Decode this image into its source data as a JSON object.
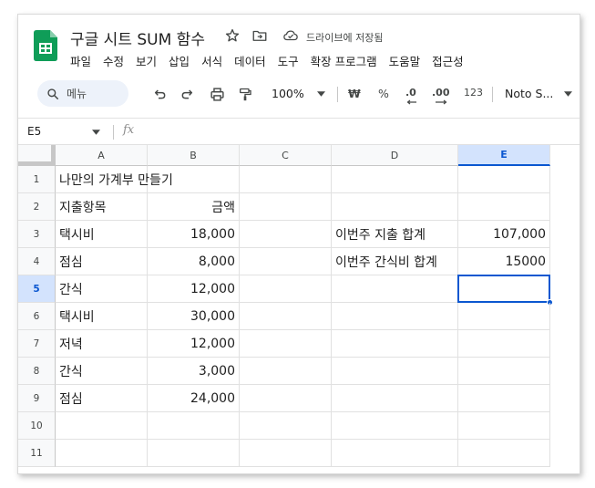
{
  "app": {
    "title": "구글 시트 SUM 함수",
    "drive_status": "드라이브에 저장됨"
  },
  "menu": [
    "파일",
    "수정",
    "보기",
    "삽입",
    "서식",
    "데이터",
    "도구",
    "확장 프로그램",
    "도움말",
    "접근성"
  ],
  "toolbar": {
    "search_label": "메뉴",
    "zoom": "100%",
    "currency": "₩",
    "percent": "%",
    "decimal_decrease": ".0",
    "decimal_increase": ".00",
    "format_more": "123",
    "font": "Noto S..."
  },
  "formula_bar": {
    "name_box": "E5",
    "fx": "fx",
    "value": ""
  },
  "sheet": {
    "columns": [
      "A",
      "B",
      "C",
      "D",
      "E"
    ],
    "selected_column": "E",
    "rows": [
      "1",
      "2",
      "3",
      "4",
      "5",
      "6",
      "7",
      "8",
      "9",
      "10",
      "11"
    ],
    "selected_row": "5",
    "selected_cell": "E5",
    "cells": {
      "A1": "나만의 가계부 만들기",
      "A2": "지출항목",
      "B2": "금액",
      "A3": "택시비",
      "B3": "18,000",
      "D3": "이번주 지출 합계",
      "E3": "107,000",
      "A4": "점심",
      "B4": "8,000",
      "D4": "이번주 간식비 합계",
      "E4": "15000",
      "A5": "간식",
      "B5": "12,000",
      "A6": "택시비",
      "B6": "30,000",
      "A7": "저녁",
      "B7": "12,000",
      "A8": "간식",
      "B8": "3,000",
      "A9": "점심",
      "B9": "24,000"
    },
    "numeric_columns": [
      "B",
      "E"
    ]
  },
  "colors": {
    "accent": "#0b57d0",
    "selected_header_bg": "#d3e3fd",
    "logo_green": "#0f9d58"
  }
}
